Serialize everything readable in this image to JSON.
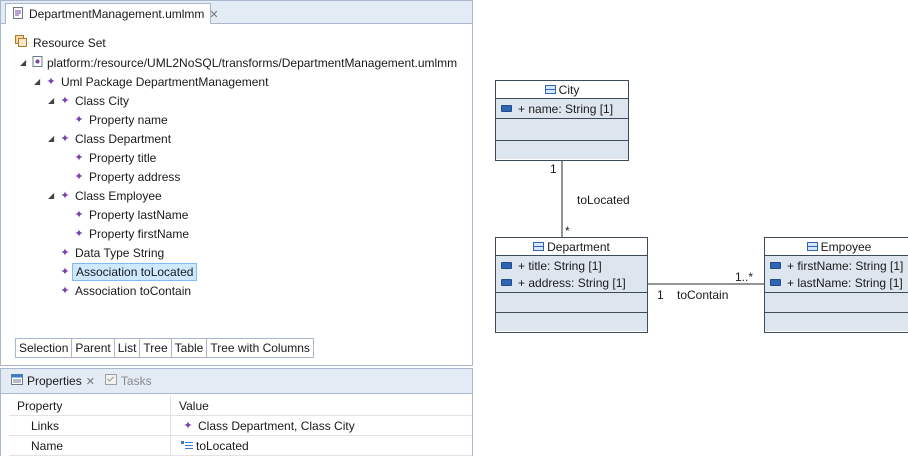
{
  "editor": {
    "tab_title": "DepartmentManagement.umlmm",
    "tab_close": "✕",
    "resource_set": "Resource Set",
    "tree": [
      {
        "label": "platform:/resource/UML2NoSQL/transforms/DepartmentManagement.umlmm",
        "depth": 0,
        "expanded": true,
        "icon": "file-icon"
      },
      {
        "label": "Uml Package DepartmentManagement",
        "depth": 1,
        "expanded": true,
        "icon": "package-icon"
      },
      {
        "label": "Class City",
        "depth": 2,
        "expanded": true,
        "icon": "element-icon"
      },
      {
        "label": "Property name",
        "depth": 3,
        "expanded": false,
        "icon": "element-icon"
      },
      {
        "label": "Class Department",
        "depth": 2,
        "expanded": true,
        "icon": "element-icon"
      },
      {
        "label": "Property title",
        "depth": 3,
        "expanded": false,
        "icon": "element-icon"
      },
      {
        "label": "Property address",
        "depth": 3,
        "expanded": false,
        "icon": "element-icon"
      },
      {
        "label": "Class Employee",
        "depth": 2,
        "expanded": true,
        "icon": "element-icon"
      },
      {
        "label": "Property lastName",
        "depth": 3,
        "expanded": false,
        "icon": "element-icon"
      },
      {
        "label": "Property firstName",
        "depth": 3,
        "expanded": false,
        "icon": "element-icon"
      },
      {
        "label": "Data Type String",
        "depth": 2,
        "expanded": false,
        "icon": "element-icon"
      },
      {
        "label": "Association toLocated",
        "depth": 2,
        "expanded": false,
        "icon": "element-icon",
        "selected": true
      },
      {
        "label": "Association toContain",
        "depth": 2,
        "expanded": false,
        "icon": "element-icon"
      }
    ],
    "bottom_tabs": [
      "Selection",
      "Parent",
      "List",
      "Tree",
      "Table",
      "Tree with Columns"
    ]
  },
  "properties": {
    "tab_label": "Properties",
    "tab_close": "✕",
    "tasks_label": "Tasks",
    "columns": [
      "Property",
      "Value"
    ],
    "rows": [
      {
        "property": "Links",
        "value": "Class Department, Class City"
      },
      {
        "property": "Name",
        "value": "toLocated"
      }
    ]
  },
  "diagram": {
    "classes": [
      {
        "name": "City",
        "attributes": [
          "+ name: String [1]"
        ]
      },
      {
        "name": "Department",
        "attributes": [
          "+ title: String [1]",
          "+ address: String [1]"
        ]
      },
      {
        "name": "Empoyee",
        "attributes": [
          "+ firstName: String [1]",
          "+ lastName: String [1]"
        ]
      }
    ],
    "associations": [
      {
        "name": "toLocated",
        "source_mult": "1",
        "target_mult": "*"
      },
      {
        "name": "toContain",
        "source_mult": "1",
        "target_mult": "1..*"
      }
    ]
  },
  "colors": {
    "accent": "#2f66b3",
    "compartment_fill": "#dde6ee",
    "selection": "#cde8ff",
    "tabbar": "#e3ebf5"
  }
}
